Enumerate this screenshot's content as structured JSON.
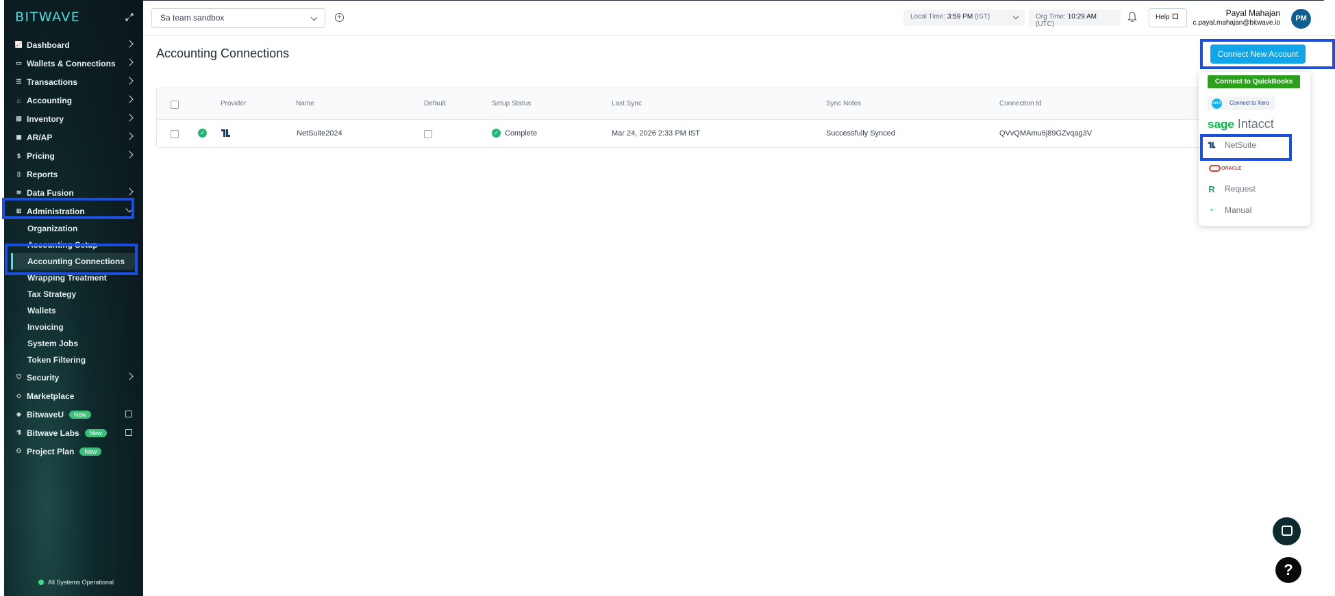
{
  "sidebar": {
    "logo": "BITWAVE",
    "items": [
      {
        "label": "Dashboard",
        "icon": "chart-line-icon"
      },
      {
        "label": "Wallets & Connections",
        "icon": "wallet-icon"
      },
      {
        "label": "Transactions",
        "icon": "list-icon"
      },
      {
        "label": "Accounting",
        "icon": "bank-icon"
      },
      {
        "label": "Inventory",
        "icon": "inventory-icon"
      },
      {
        "label": "AR/AP",
        "icon": "invoice-icon"
      },
      {
        "label": "Pricing",
        "icon": "dollar-icon"
      },
      {
        "label": "Reports",
        "icon": "report-icon"
      },
      {
        "label": "Data Fusion",
        "icon": "database-icon"
      },
      {
        "label": "Administration",
        "icon": "admin-icon"
      }
    ],
    "admin_sub": [
      "Organization",
      "Accounting Setup",
      "Accounting Connections",
      "Wrapping Treatment",
      "Tax Strategy",
      "Wallets",
      "Invoicing",
      "System Jobs",
      "Token Filtering"
    ],
    "bottom_items": [
      {
        "label": "Security"
      },
      {
        "label": "Marketplace"
      },
      {
        "label": "BitwaveU",
        "badge": "New"
      },
      {
        "label": "Bitwave Labs",
        "badge": "New"
      },
      {
        "label": "Project Plan",
        "badge": "New"
      }
    ],
    "status": "All Systems Operational"
  },
  "topbar": {
    "org": "Sa team sandbox",
    "local_time_label": "Local Time:",
    "local_time": "3:59 PM",
    "local_tz": "(IST)",
    "org_time_label": "Org Time:",
    "org_time": "10:29 AM",
    "org_tz": "(UTC)",
    "help": "Help",
    "user_name": "Payal Mahajan",
    "user_email": "c.payal.mahajan@bitwave.io",
    "avatar": "PM"
  },
  "main": {
    "title": "Accounting Connections",
    "connect_button": "Connect New Account",
    "columns": [
      "Provider",
      "Name",
      "Default",
      "Setup Status",
      "Last Sync",
      "Sync Notes",
      "Connection Id"
    ],
    "row": {
      "name": "NetSuite2024",
      "status": "Complete",
      "last_sync": "Mar 24, 2026 2:33 PM IST",
      "sync_notes": "Successfully Synced",
      "connection_id": "QVvQMAmu6j89GZvqag3V"
    }
  },
  "dropdown": {
    "quickbooks": "Connect to QuickBooks",
    "xero": "Connect to Xero",
    "sage_a": "sage",
    "sage_b": "Intacct",
    "netsuite": "NetSuite",
    "oracle": "ORACLE",
    "request": "Request",
    "manual": "Manual"
  },
  "colors": {
    "accent": "#0ea5e9",
    "highlight": "#1a4fe0",
    "success": "#22b573",
    "sidebar_bg": "#0c1c20"
  }
}
